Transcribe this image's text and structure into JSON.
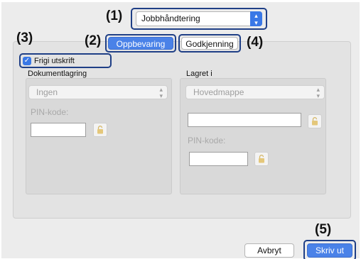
{
  "annotations": {
    "n1": "(1)",
    "n2": "(2)",
    "n3": "(3)",
    "n4": "(4)",
    "n5": "(5)"
  },
  "job_select": {
    "value": "Jobbhåndtering"
  },
  "tabs": [
    {
      "label": "Oppbevaring",
      "selected": true
    },
    {
      "label": "Godkjenning",
      "selected": false
    }
  ],
  "release_print": {
    "label": "Frigi utskrift",
    "checked": true
  },
  "document_storage": {
    "title": "Dokumentlagring",
    "select_value": "Ingen",
    "pin_label": "PIN-kode:"
  },
  "stored_in": {
    "title": "Lagret i",
    "select_value": "Hovedmappe",
    "pin_label": "PIN-kode:"
  },
  "buttons": {
    "cancel": "Avbryt",
    "print": "Skriv ut"
  },
  "colors": {
    "accent": "#4a82e8",
    "highlight_border": "#1f3f86"
  }
}
